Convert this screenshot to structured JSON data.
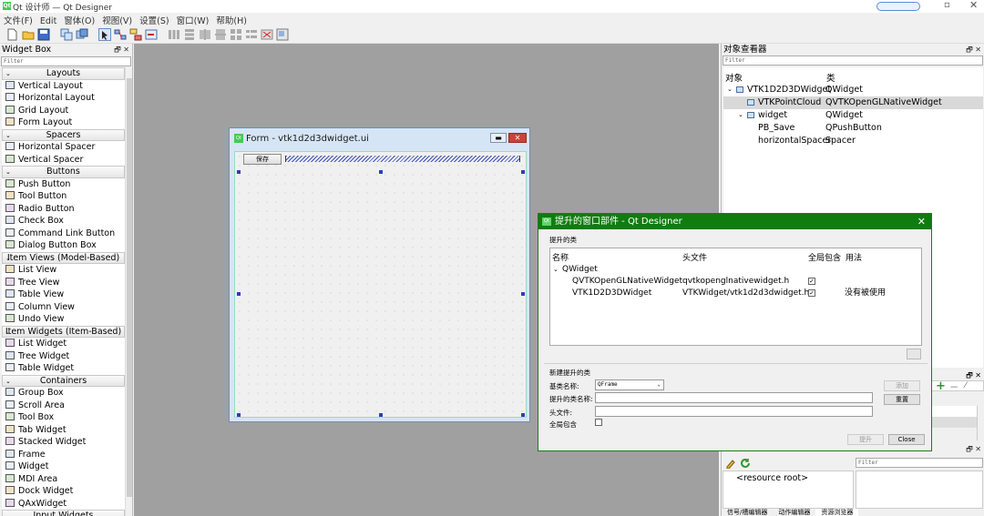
{
  "app": {
    "title": "Qt 设计师 — Qt Designer",
    "icon": "qt-logo-icon"
  },
  "menubar": [
    "文件(F)",
    "Edit",
    "窗体(O)",
    "视图(V)",
    "设置(S)",
    "窗口(W)",
    "帮助(H)"
  ],
  "widget_box": {
    "title": "Widget Box",
    "filter_placeholder": "Filter",
    "sections": [
      {
        "category": "Layouts",
        "items": [
          "Vertical Layout",
          "Horizontal Layout",
          "Grid Layout",
          "Form Layout"
        ]
      },
      {
        "category": "Spacers",
        "items": [
          "Horizontal Spacer",
          "Vertical Spacer"
        ]
      },
      {
        "category": "Buttons",
        "items": [
          "Push Button",
          "Tool Button",
          "Radio Button",
          "Check Box",
          "Command Link Button",
          "Dialog Button Box"
        ]
      },
      {
        "category": "Item Views (Model-Based)",
        "items": [
          "List View",
          "Tree View",
          "Table View",
          "Column View",
          "Undo View"
        ]
      },
      {
        "category": "Item Widgets (Item-Based)",
        "items": [
          "List Widget",
          "Tree Widget",
          "Table Widget"
        ]
      },
      {
        "category": "Containers",
        "items": [
          "Group Box",
          "Scroll Area",
          "Tool Box",
          "Tab Widget",
          "Stacked Widget",
          "Frame",
          "Widget",
          "MDI Area",
          "Dock Widget",
          "QAxWidget"
        ]
      },
      {
        "category": "Input Widgets",
        "items": []
      }
    ]
  },
  "form": {
    "title": "Form - vtk1d2d3dwidget.ui",
    "save_button": "保存"
  },
  "object_inspector": {
    "title": "对象查看器",
    "filter_placeholder": "Filter",
    "col_object": "对象",
    "col_class": "类",
    "rows": [
      {
        "name": "VTK1D2D3DWidget",
        "class": "QWidget",
        "level": 0,
        "expander": "v"
      },
      {
        "name": "VTKPointCloud",
        "class": "QVTKOpenGLNativeWidget",
        "level": 1,
        "expander": "",
        "selected": true
      },
      {
        "name": "widget",
        "class": "QWidget",
        "level": 1,
        "expander": "v"
      },
      {
        "name": "PB_Save",
        "class": "QPushButton",
        "level": 2,
        "expander": ""
      },
      {
        "name": "horizontalSpacer",
        "class": "Spacer",
        "level": 2,
        "expander": ""
      }
    ]
  },
  "resource_browser": {
    "filter_placeholder": "Filter",
    "root": "<resource root>",
    "tabs": [
      "信号/槽编辑器",
      "动作编辑器",
      "资源浏览器"
    ]
  },
  "dialog": {
    "title": "提升的窗口部件 - Qt Designer",
    "promoted_group": "提升的类",
    "headers": [
      "名称",
      "头文件",
      "全局包含",
      "用法"
    ],
    "rows": [
      {
        "name": "QWidget",
        "header": "",
        "global": null,
        "usage": "",
        "level": 0
      },
      {
        "name": "QVTKOpenGLNativeWidget",
        "header": "qvtkopenglnativewidget.h",
        "global": true,
        "usage": "",
        "level": 1
      },
      {
        "name": "VTK1D2D3DWidget",
        "header": "VTKWidget/vtk1d2d3dwidget.h",
        "global": true,
        "usage": "没有被使用",
        "level": 1
      }
    ],
    "new_group": "新建提升的类",
    "base_class_label": "基类名称:",
    "base_class_value": "QFrame",
    "promoted_class_label": "提升的类名称:",
    "header_file_label": "头文件:",
    "global_include_label": "全局包含",
    "add_button": "添加",
    "reset_button": "重置",
    "promote_button": "提升",
    "close_button": "Close"
  }
}
